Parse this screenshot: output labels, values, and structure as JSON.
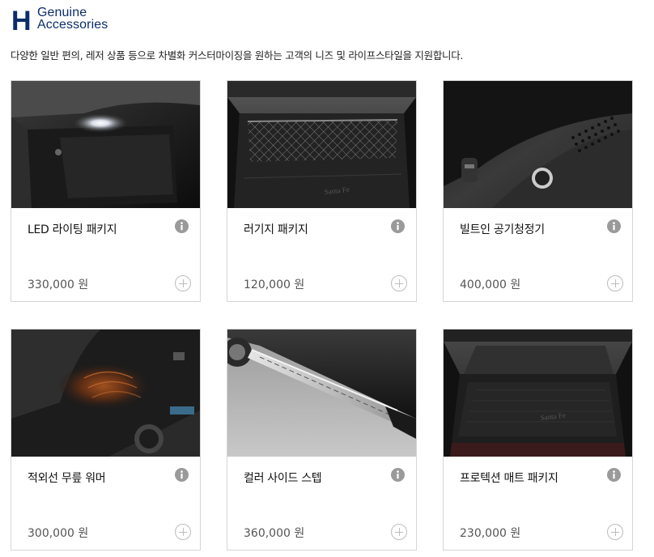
{
  "brand": {
    "logo_letter": "H",
    "line1": "Genuine",
    "line2": "Accessories",
    "color": "#0b2d6b"
  },
  "intro": "다양한 일반 편의, 레저 상품 등으로 차별화 커스터마이징을 원하는 고객의 니즈 및 라이프스타일을 지원합니다.",
  "products": [
    {
      "name": "LED 라이팅 패키지",
      "price": "330,000 원",
      "image": "glovebox-led-photo"
    },
    {
      "name": "러기지 패키지",
      "price": "120,000 원",
      "image": "cargo-net-photo"
    },
    {
      "name": "빌트인 공기청정기",
      "price": "400,000 원",
      "image": "air-purifier-photo"
    },
    {
      "name": "적외선 무릎 워머",
      "price": "300,000 원",
      "image": "knee-warmer-photo"
    },
    {
      "name": "컬러 사이드 스텝",
      "price": "360,000 원",
      "image": "side-step-photo"
    },
    {
      "name": "프로텍션 매트 패키지",
      "price": "230,000 원",
      "image": "trunk-mat-photo"
    }
  ],
  "icons": {
    "info": "info-icon",
    "add": "plus-circle-icon"
  }
}
